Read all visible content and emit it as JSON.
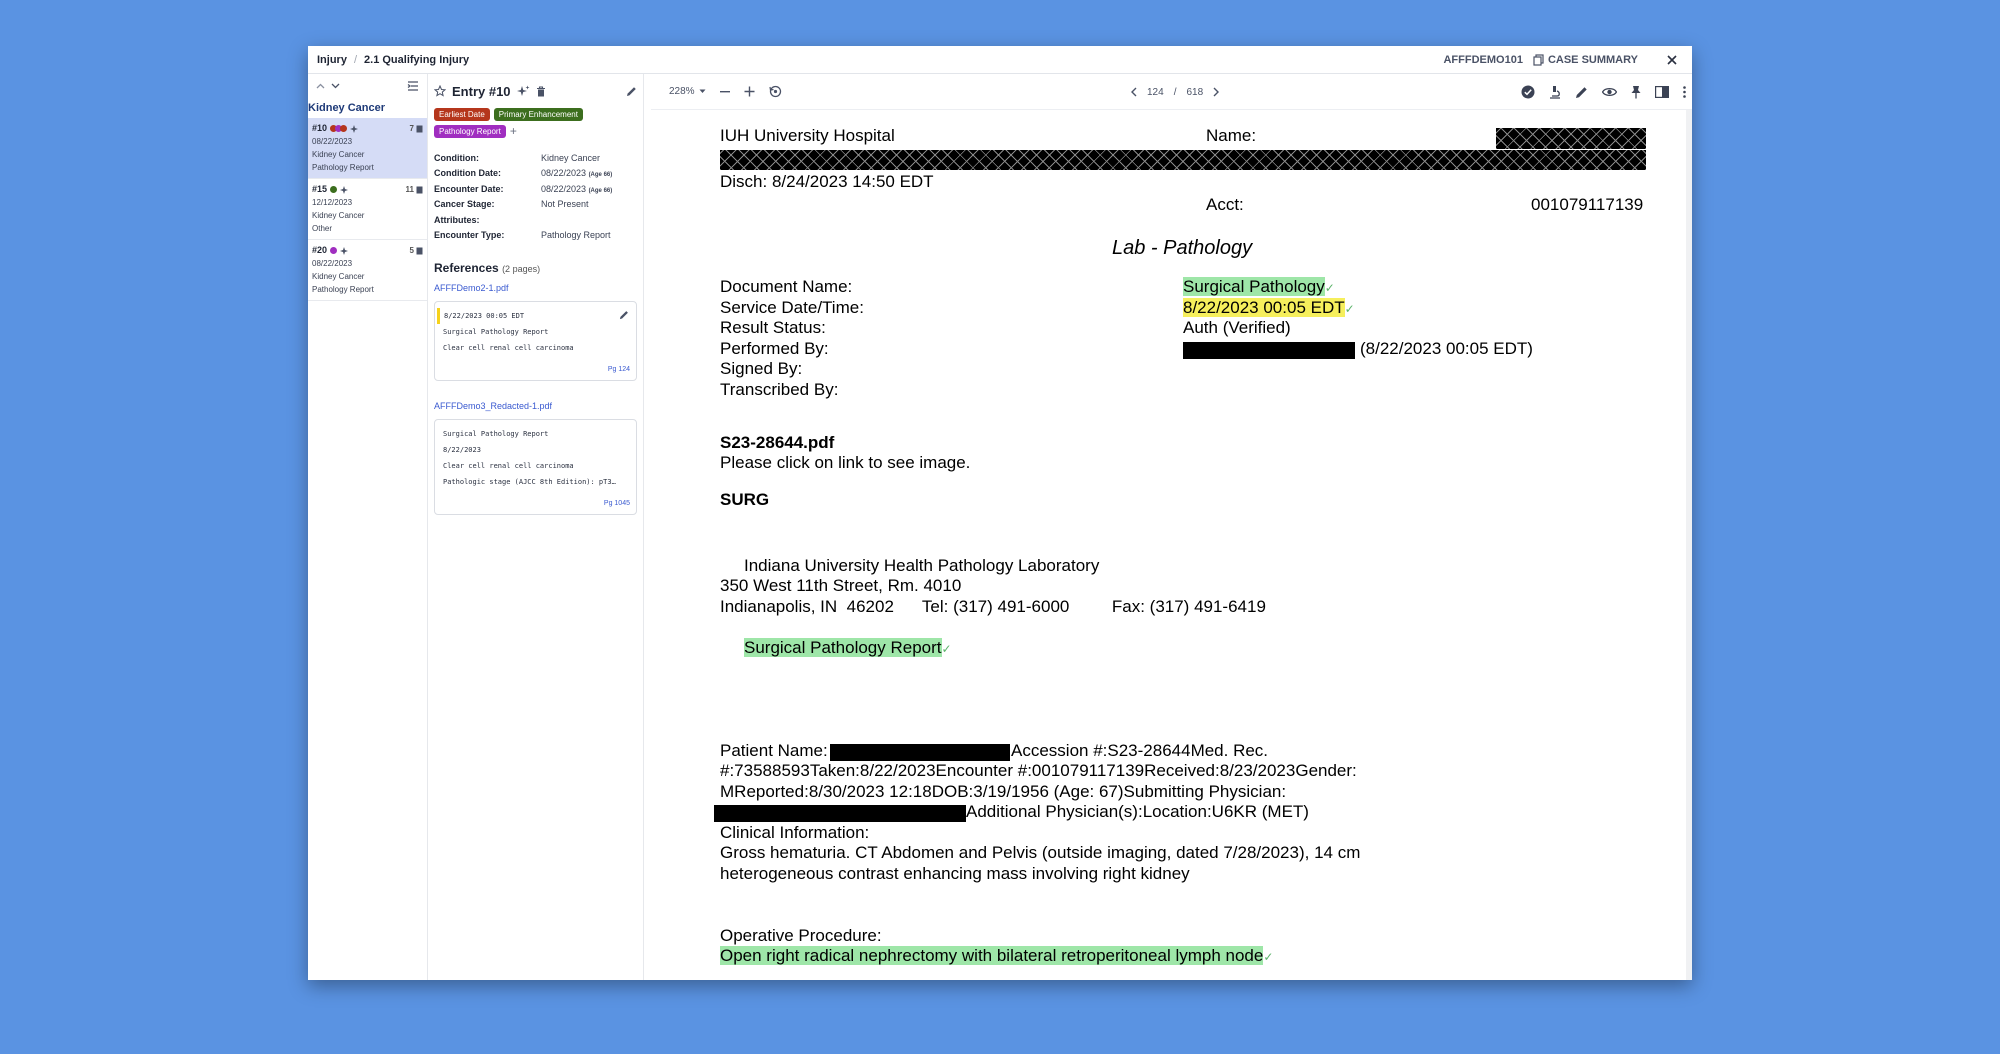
{
  "breadcrumb": {
    "parent": "Injury",
    "current": "2.1 Qualifying Injury"
  },
  "header": {
    "case_id": "AFFFDEMO101",
    "case_summary": "CASE SUMMARY"
  },
  "left": {
    "title": "Kidney Cancer",
    "entries": [
      {
        "id": "#10",
        "date": "08/22/2023",
        "condition": "Kidney Cancer",
        "type": "Pathology Report",
        "count": "7"
      },
      {
        "id": "#15",
        "date": "12/12/2023",
        "condition": "Kidney Cancer",
        "type": "Other",
        "count": "11"
      },
      {
        "id": "#20",
        "date": "08/22/2023",
        "condition": "Kidney Cancer",
        "type": "Pathology Report",
        "count": "5"
      }
    ]
  },
  "entry": {
    "title": "Entry #10",
    "tags": [
      {
        "label": "Earliest Date",
        "color": "#b5361c"
      },
      {
        "label": "Primary Enhancement",
        "color": "#3c6e1e"
      },
      {
        "label": "Pathology Report",
        "color": "#a02ec0"
      }
    ],
    "fields": [
      {
        "label": "Condition:",
        "value": "Kidney Cancer",
        "age": ""
      },
      {
        "label": "Condition Date:",
        "value": "08/22/2023",
        "age": "(Age 66)"
      },
      {
        "label": "Encounter Date:",
        "value": "08/22/2023",
        "age": "(Age 66)"
      },
      {
        "label": "Cancer Stage:",
        "value": "Not Present",
        "age": ""
      },
      {
        "label": "Attributes:",
        "value": "",
        "age": ""
      },
      {
        "label": "Encounter Type:",
        "value": "Pathology Report",
        "age": ""
      }
    ],
    "references_title": "References",
    "references_count": "(2 pages)",
    "refs": [
      {
        "file": "AFFFDemo2-1.pdf",
        "lines": [
          "8/22/2023 00:05 EDT",
          "Surgical Pathology Report",
          "Clear cell renal cell carcinoma"
        ],
        "page": "Pg 124"
      },
      {
        "file": "AFFFDemo3_Redacted-1.pdf",
        "lines": [
          "Surgical Pathology Report",
          "8/22/2023",
          "Clear cell renal cell carcinoma",
          "Pathologic stage (AJCC 8th Edition): pT3…"
        ],
        "page": "Pg 1045"
      }
    ]
  },
  "viewer": {
    "zoom": "228%",
    "page": "124",
    "sep": "/",
    "total": "618"
  },
  "doc": {
    "hospital": "IUH University Hospital",
    "name_label": "Name:",
    "disch": "Disch:  8/24/2023 14:50 EDT",
    "acct_label": "Acct:",
    "acct_value": "001079117139",
    "section_title": "Lab - Pathology",
    "labels": [
      "Document Name:",
      "Service Date/Time:",
      "Result Status:",
      "Performed By:",
      "Signed By:",
      "Transcribed By:"
    ],
    "doc_name": "Surgical Pathology",
    "service_dt": "8/22/2023 00:05 EDT",
    "result_status": "Auth (Verified)",
    "performed_suffix": "(8/22/2023 00:05 EDT)",
    "pdf_name": "S23-28644.pdf",
    "pdf_note": "Please click on link to see image.",
    "surg": "SURG",
    "lab_name": "Indiana University Health Pathology Laboratory",
    "lab_addr": "350 West 11th Street, Rm. 4010",
    "lab_city": "Indianapolis, IN  46202      Tel: (317) 491-6000         Fax: (317) 491-6419",
    "report_title": "Surgical Pathology Report",
    "patient_line1_a": "Patient Name:",
    "patient_line1_b": "Accession #:S23-28644Med. Rec.",
    "patient_line2": "#:73588593Taken:8/22/2023Encounter #:001079117139Received:8/23/2023Gender:",
    "patient_line3": "MReported:8/30/2023 12:18DOB:3/19/1956 (Age: 67)Submitting Physician:",
    "patient_line4": "Additional Physician(s):Location:U6KR (MET)",
    "clinical_label": "Clinical Information:",
    "clinical_1": "Gross hematuria. CT Abdomen and Pelvis (outside imaging, dated 7/28/2023), 14 cm",
    "clinical_2": "heterogeneous contrast enhancing mass involving right kidney",
    "operative_label": "Operative Procedure:",
    "operative_1": "Open right radical nephrectomy with bilateral retroperitoneal lymph node"
  }
}
